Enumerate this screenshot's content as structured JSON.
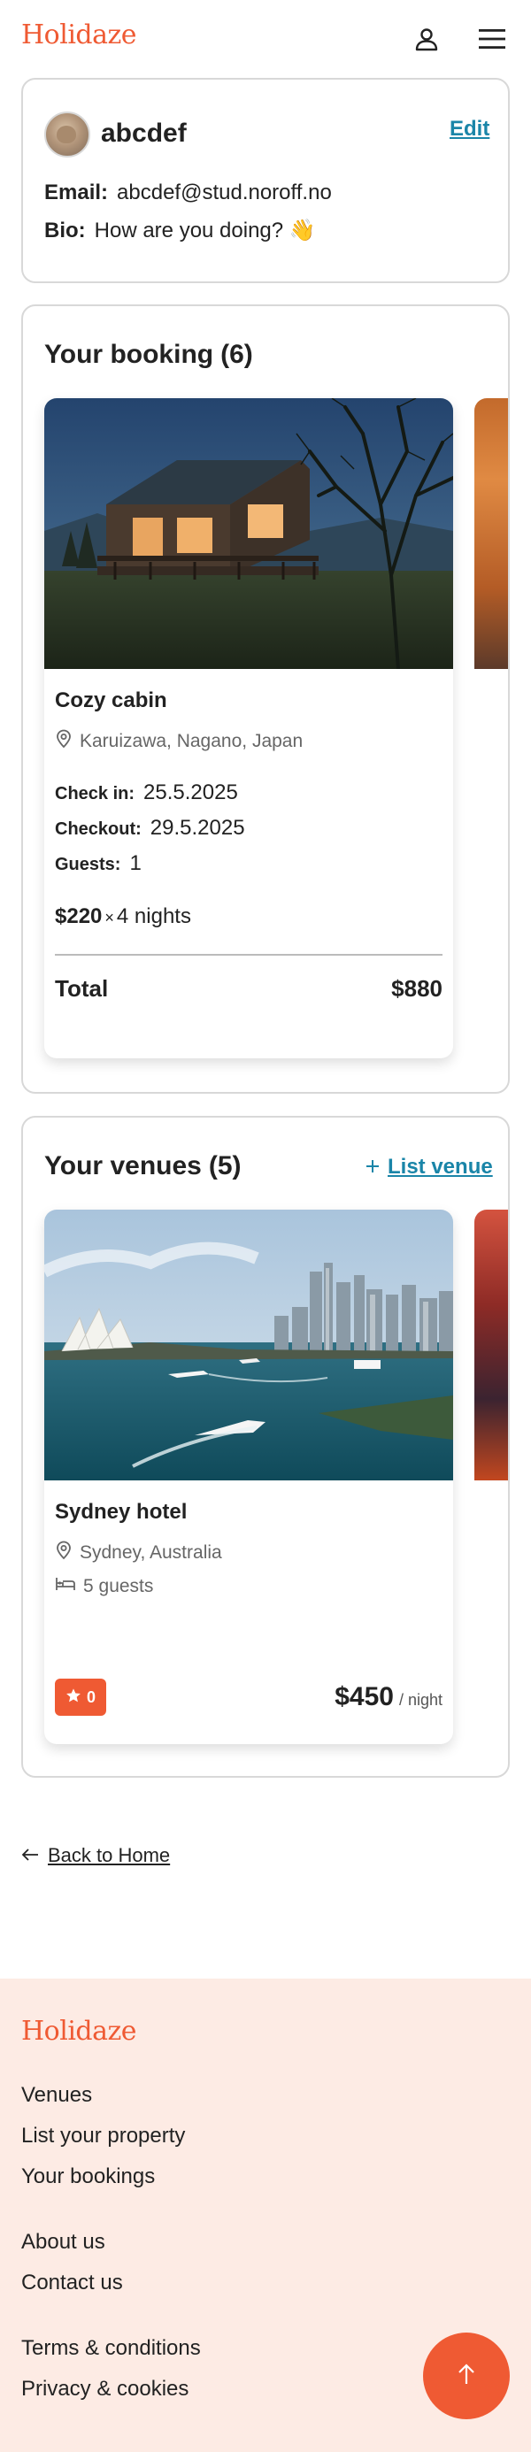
{
  "header": {
    "logo": "Holidaze",
    "profile_icon": "user-icon",
    "menu_icon": "hamburger-menu-icon"
  },
  "profile": {
    "name": "abcdef",
    "edit_label": "Edit",
    "email_label": "Email:",
    "email": "abcdef@stud.noroff.no",
    "bio_label": "Bio:",
    "bio": "How are you doing? 👋"
  },
  "bookings": {
    "title": "Your booking",
    "count": "(6)",
    "items": [
      {
        "name": "Cozy cabin",
        "location": "Karuizawa, Nagano, Japan",
        "checkin_label": "Check in:",
        "checkin": "25.5.2025",
        "checkout_label": "Checkout:",
        "checkout": "29.5.2025",
        "guests_label": "Guests:",
        "guests": "1",
        "price": "$220",
        "times": "×",
        "nights": "4 nights",
        "total_label": "Total",
        "total": "$880"
      }
    ]
  },
  "venues": {
    "title": "Your venues",
    "count": "(5)",
    "list_label": "List venue",
    "items": [
      {
        "name": "Sydney hotel",
        "location": "Sydney, Australia",
        "guests": "5 guests",
        "rating": "0",
        "price": "$450",
        "per": "/ night"
      }
    ]
  },
  "back_label": "Back to Home",
  "footer": {
    "logo": "Holidaze",
    "links": [
      "Venues",
      "List your property",
      "Your bookings",
      "About us",
      "Contact us",
      "Terms & conditions",
      "Privacy & cookies"
    ],
    "top_icon": "arrow-up-icon"
  },
  "colors": {
    "brand": "#ef5a33",
    "link": "#1a85a8",
    "footer_bg": "#fdebe4"
  }
}
